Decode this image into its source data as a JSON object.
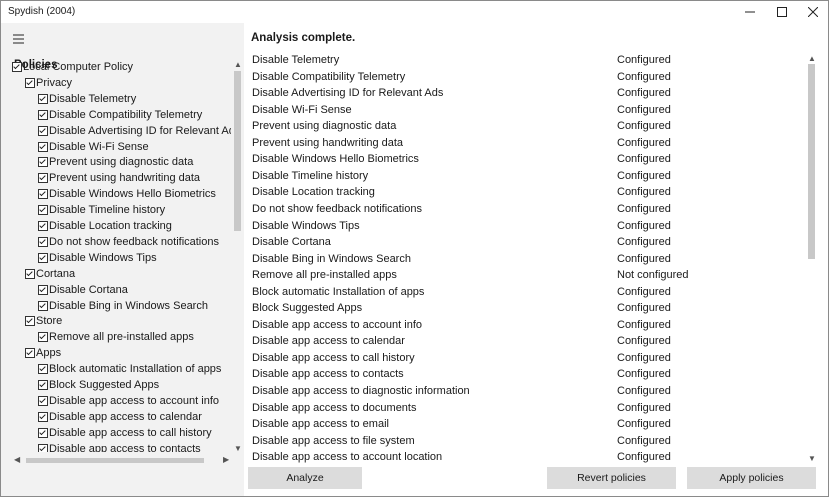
{
  "window": {
    "title": "Spydish (2004)"
  },
  "left_panel": {
    "menu_icon": "hamburger-icon",
    "heading": "Policies",
    "tree": [
      {
        "label": "Local Computer Policy",
        "level": 0
      },
      {
        "label": "Privacy",
        "level": 1
      },
      {
        "label": "Disable Telemetry",
        "level": 2
      },
      {
        "label": "Disable Compatibility Telemetry",
        "level": 2
      },
      {
        "label": "Disable Advertising ID for Relevant Ads",
        "level": 2
      },
      {
        "label": "Disable Wi-Fi Sense",
        "level": 2
      },
      {
        "label": "Prevent using diagnostic data",
        "level": 2
      },
      {
        "label": "Prevent using handwriting data",
        "level": 2
      },
      {
        "label": "Disable Windows Hello Biometrics",
        "level": 2
      },
      {
        "label": "Disable Timeline history",
        "level": 2
      },
      {
        "label": "Disable Location tracking",
        "level": 2
      },
      {
        "label": "Do not show feedback notifications",
        "level": 2
      },
      {
        "label": "Disable Windows Tips",
        "level": 2
      },
      {
        "label": "Cortana",
        "level": 1
      },
      {
        "label": "Disable Cortana",
        "level": 2
      },
      {
        "label": "Disable Bing in Windows Search",
        "level": 2
      },
      {
        "label": "Store",
        "level": 1
      },
      {
        "label": "Remove all pre-installed apps",
        "level": 2
      },
      {
        "label": "Apps",
        "level": 1
      },
      {
        "label": "Block automatic Installation of apps",
        "level": 2
      },
      {
        "label": "Block Suggested Apps",
        "level": 2
      },
      {
        "label": "Disable app access to account info",
        "level": 2
      },
      {
        "label": "Disable app access to calendar",
        "level": 2
      },
      {
        "label": "Disable app access to call history",
        "level": 2
      },
      {
        "label": "Disable app access to contacts",
        "level": 2
      }
    ]
  },
  "main": {
    "status_heading": "Analysis complete.",
    "results": [
      {
        "name": "Disable Telemetry",
        "status": "Configured"
      },
      {
        "name": "Disable Compatibility Telemetry",
        "status": "Configured"
      },
      {
        "name": "Disable Advertising ID for Relevant Ads",
        "status": "Configured"
      },
      {
        "name": "Disable Wi-Fi Sense",
        "status": "Configured"
      },
      {
        "name": "Prevent using diagnostic data",
        "status": "Configured"
      },
      {
        "name": "Prevent using handwriting data",
        "status": "Configured"
      },
      {
        "name": "Disable Windows Hello Biometrics",
        "status": "Configured"
      },
      {
        "name": "Disable Timeline history",
        "status": "Configured"
      },
      {
        "name": "Disable Location tracking",
        "status": "Configured"
      },
      {
        "name": "Do not show feedback notifications",
        "status": "Configured"
      },
      {
        "name": "Disable Windows Tips",
        "status": "Configured"
      },
      {
        "name": "Disable Cortana",
        "status": "Configured"
      },
      {
        "name": "Disable Bing in Windows Search",
        "status": "Configured"
      },
      {
        "name": "Remove all pre-installed apps",
        "status": "Not configured"
      },
      {
        "name": "Block automatic Installation of apps",
        "status": "Configured"
      },
      {
        "name": "Block Suggested Apps",
        "status": "Configured"
      },
      {
        "name": "Disable app access to account info",
        "status": "Configured"
      },
      {
        "name": "Disable app access to calendar",
        "status": "Configured"
      },
      {
        "name": "Disable app access to call history",
        "status": "Configured"
      },
      {
        "name": "Disable app access to contacts",
        "status": "Configured"
      },
      {
        "name": "Disable app access to diagnostic information",
        "status": "Configured"
      },
      {
        "name": "Disable app access to documents",
        "status": "Configured"
      },
      {
        "name": "Disable app access to email",
        "status": "Configured"
      },
      {
        "name": "Disable app access to file system",
        "status": "Configured"
      },
      {
        "name": "Disable app access to account location",
        "status": "Configured"
      }
    ]
  },
  "buttons": {
    "analyze": "Analyze",
    "revert": "Revert policies",
    "apply": "Apply policies"
  },
  "colors": {
    "sidebar_bg": "#f2f2f2",
    "button_bg": "#dcdcdc"
  }
}
